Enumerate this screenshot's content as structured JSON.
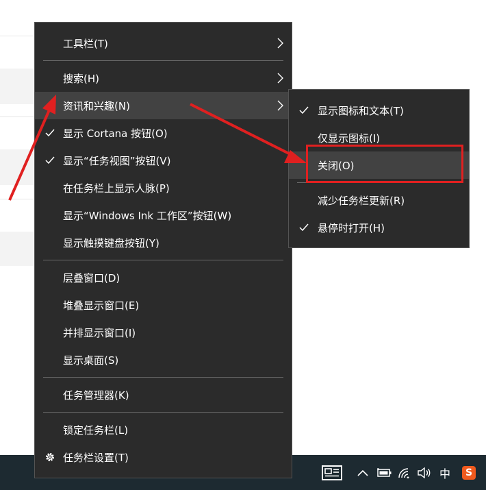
{
  "main_menu": {
    "items": [
      {
        "label": "工具栏(T)",
        "checked": false,
        "submenu": true
      },
      {
        "label": "搜索(H)",
        "checked": false,
        "submenu": true
      },
      {
        "label": "资讯和兴趣(N)",
        "checked": false,
        "submenu": true,
        "highlighted": true
      },
      {
        "label": "显示 Cortana 按钮(O)",
        "checked": true
      },
      {
        "label": "显示“任务视图”按钮(V)",
        "checked": true
      },
      {
        "label": "在任务栏上显示人脉(P)",
        "checked": false
      },
      {
        "label": "显示“Windows Ink 工作区”按钮(W)",
        "checked": false
      },
      {
        "label": "显示触摸键盘按钮(Y)",
        "checked": false
      },
      {
        "label": "层叠窗口(D)",
        "checked": false
      },
      {
        "label": "堆叠显示窗口(E)",
        "checked": false
      },
      {
        "label": "并排显示窗口(I)",
        "checked": false
      },
      {
        "label": "显示桌面(S)",
        "checked": false
      },
      {
        "label": "任务管理器(K)",
        "checked": false
      },
      {
        "label": "锁定任务栏(L)",
        "checked": false
      },
      {
        "label": "任务栏设置(T)",
        "icon": "gear-icon"
      }
    ]
  },
  "submenu": {
    "items": [
      {
        "label": "显示图标和文本(T)",
        "checked": true
      },
      {
        "label": "仅显示图标(I)",
        "checked": false
      },
      {
        "label": "关闭(O)",
        "checked": false,
        "highlighted": true
      },
      {
        "label": "减少任务栏更新(R)",
        "checked": false
      },
      {
        "label": "悬停时打开(H)",
        "checked": true
      }
    ]
  },
  "taskbar": {
    "news_icon": "news-icon",
    "ime_label": "中",
    "sogou_label": "S"
  },
  "colors": {
    "menu_bg": "#2b2b2b",
    "highlight": "#424242",
    "taskbar": "#1d2a31",
    "annotation": "#e02020",
    "sogou": "#f05a1e"
  }
}
